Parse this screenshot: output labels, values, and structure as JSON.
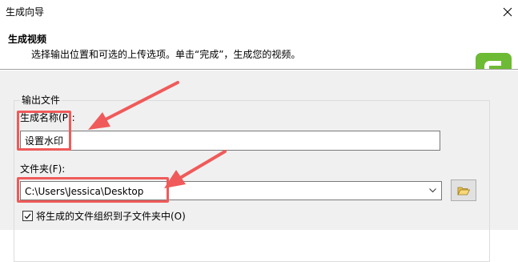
{
  "window": {
    "title": "生成向导"
  },
  "header": {
    "title": "生成视频",
    "subtitle": "选择输出位置和可选的上传选项。单击“完成”，生成您的视频。",
    "logo_icon": "camtasia-logo-icon",
    "logo_color": "#6dbb34"
  },
  "output_group": {
    "label": "输出文件",
    "name_label": "生成名称(P):",
    "name_value": "设置水印",
    "folder_label": "文件夹(F):",
    "folder_value": "C:\\Users\\Jessica\\Desktop",
    "browse_icon": "folder-open-icon",
    "subfolder_checkbox_label": "将生成的文件组织到子文件夹中(O)",
    "subfolder_checked": true
  },
  "annotations": {
    "highlight_color": "#f05a5a"
  }
}
